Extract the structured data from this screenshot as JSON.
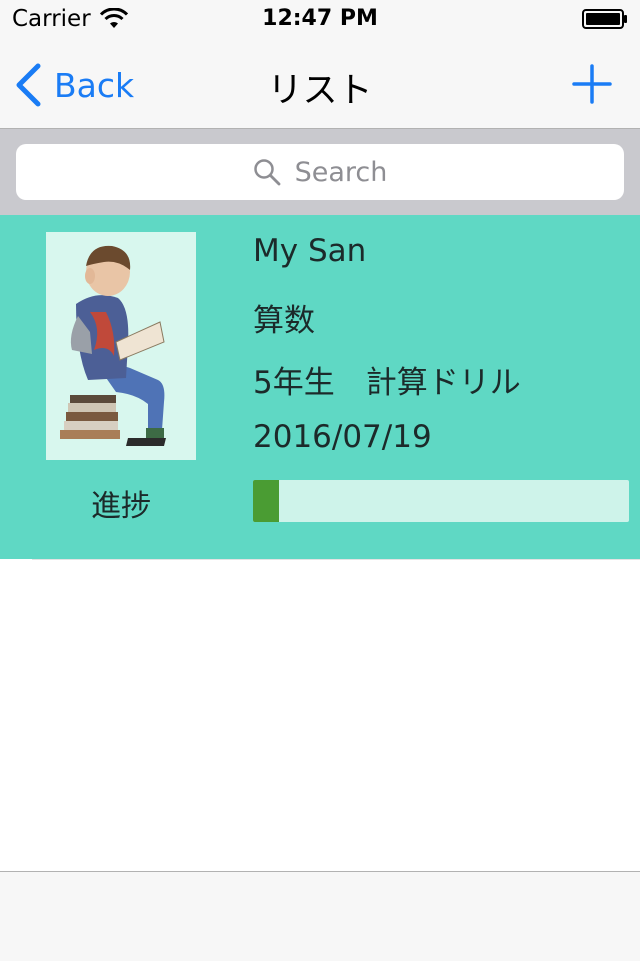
{
  "status_bar": {
    "carrier": "Carrier",
    "time": "12:47 PM"
  },
  "nav": {
    "back_label": "Back",
    "title": "リスト",
    "add_icon": "plus-icon"
  },
  "search": {
    "placeholder": "Search",
    "icon": "magnifier-icon"
  },
  "list": {
    "items": [
      {
        "name": "My San",
        "subject": "算数",
        "detail": "5年生　計算ドリル",
        "date": "2016/07/19",
        "progress_label": "進捗",
        "progress_fraction": 0.07
      }
    ]
  },
  "colors": {
    "accent": "#1a7cf5",
    "cell_background": "#5fd8c4",
    "progress_fill": "#4a9c33",
    "progress_track": "#cef3ea"
  }
}
